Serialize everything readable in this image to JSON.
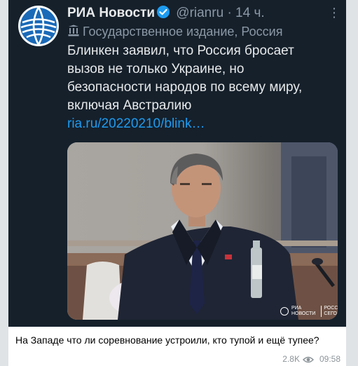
{
  "tweet": {
    "account_name": "РИА Новости",
    "handle": "@rianru",
    "separator": "·",
    "time_ago": "14 ч.",
    "more_icon": "more-icon",
    "affiliation": "Государственное издание, Россия",
    "text_lines": [
      "Блинкен заявил, что Россия бросает",
      "вызов не только Украине, но",
      "безопасности народов по всему миру,",
      "включая Австралию"
    ],
    "link": "ria.ru/20220210/blink…",
    "watermark_top": "РИА",
    "watermark_bottom": "НОВОСТИ",
    "watermark_right_top": "РОССИЯ",
    "watermark_right_bottom": "СЕГОДНЯ"
  },
  "message": {
    "caption": "На Западе что ли соревнование устроили, кто тупой и ещё тупее?",
    "views": "2.8K",
    "views_icon": "eye-icon",
    "time": "09:58"
  },
  "colors": {
    "tweet_bg": "#15202b",
    "link": "#1d9bf0",
    "verified": "#1d9bf0"
  }
}
